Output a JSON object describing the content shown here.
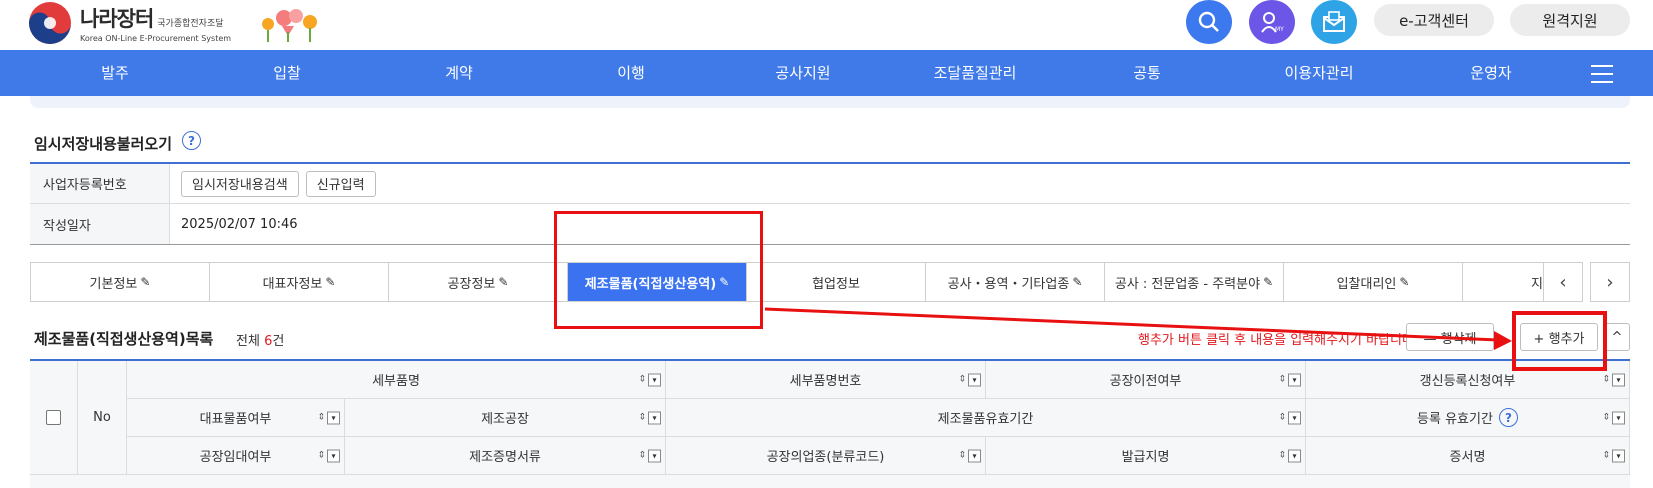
{
  "header": {
    "logo": {
      "title": "나라장터",
      "subtitle": "국가종합전자조달",
      "english": "Korea ON-Line E-Procurement System"
    },
    "icons": [
      "search-icon",
      "my-user-icon",
      "mail-icon"
    ],
    "buttons": {
      "customer_center": "e-고객센터",
      "remote_support": "원격지원"
    }
  },
  "nav": {
    "items": [
      "발주",
      "입찰",
      "계약",
      "이행",
      "공사지원",
      "조달품질관리",
      "공통",
      "이용자관리",
      "운영자"
    ]
  },
  "temp_section": {
    "title": "임시저장내용불러오기",
    "rows": {
      "bizno_label": "사업자등록번호",
      "search_button": "임시저장내용검색",
      "new_button": "신규입력",
      "date_label": "작성일자",
      "date_value": "2025/02/07 10:46"
    }
  },
  "tabs": {
    "items": [
      {
        "label": "기본정보",
        "pencil": "✎"
      },
      {
        "label": "대표자정보",
        "pencil": "✎"
      },
      {
        "label": "공장정보",
        "pencil": "✎"
      },
      {
        "label": "제조물품(직접생산용역)",
        "pencil": "✎"
      },
      {
        "label": "협업정보",
        "pencil": ""
      },
      {
        "label": "공사・용역・기타업종",
        "pencil": "✎"
      },
      {
        "label": "공사 : 전문업종 - 주력분야",
        "pencil": "✎"
      },
      {
        "label": "입찰대리인",
        "pencil": "✎"
      },
      {
        "label": "지",
        "pencil": ""
      }
    ],
    "prev_arrow": "‹",
    "next_arrow": "›"
  },
  "list": {
    "title": "제조물품(직접생산용역)목록",
    "count_prefix": "전체 ",
    "count": "6",
    "count_suffix": "건",
    "notice": "행추가 버튼 클릭 후 내용을 입력해주시기 바랍니다.",
    "delete_row": "— 행삭제",
    "add_row": "+ 행추가",
    "collapse": "^"
  },
  "grid": {
    "no_label": "No",
    "row1": [
      "세부품명",
      "세부품명번호",
      "공장이전여부",
      "갱신등록신청여부"
    ],
    "row2": [
      "대표물품여부",
      "제조공장",
      "제조물품유효기간",
      "등록 유효기간"
    ],
    "row3": [
      "공장임대여부",
      "제조증명서류",
      "공장의업종(분류코드)",
      "발급지명",
      "증서명"
    ],
    "sort_arrows": "⇕",
    "filter_glyph": "▾"
  },
  "colors": {
    "nav_blue": "#3f7ae8",
    "active_tab": "#3b72f0",
    "annotation_red": "#e81010",
    "count_red": "#e0191e"
  }
}
